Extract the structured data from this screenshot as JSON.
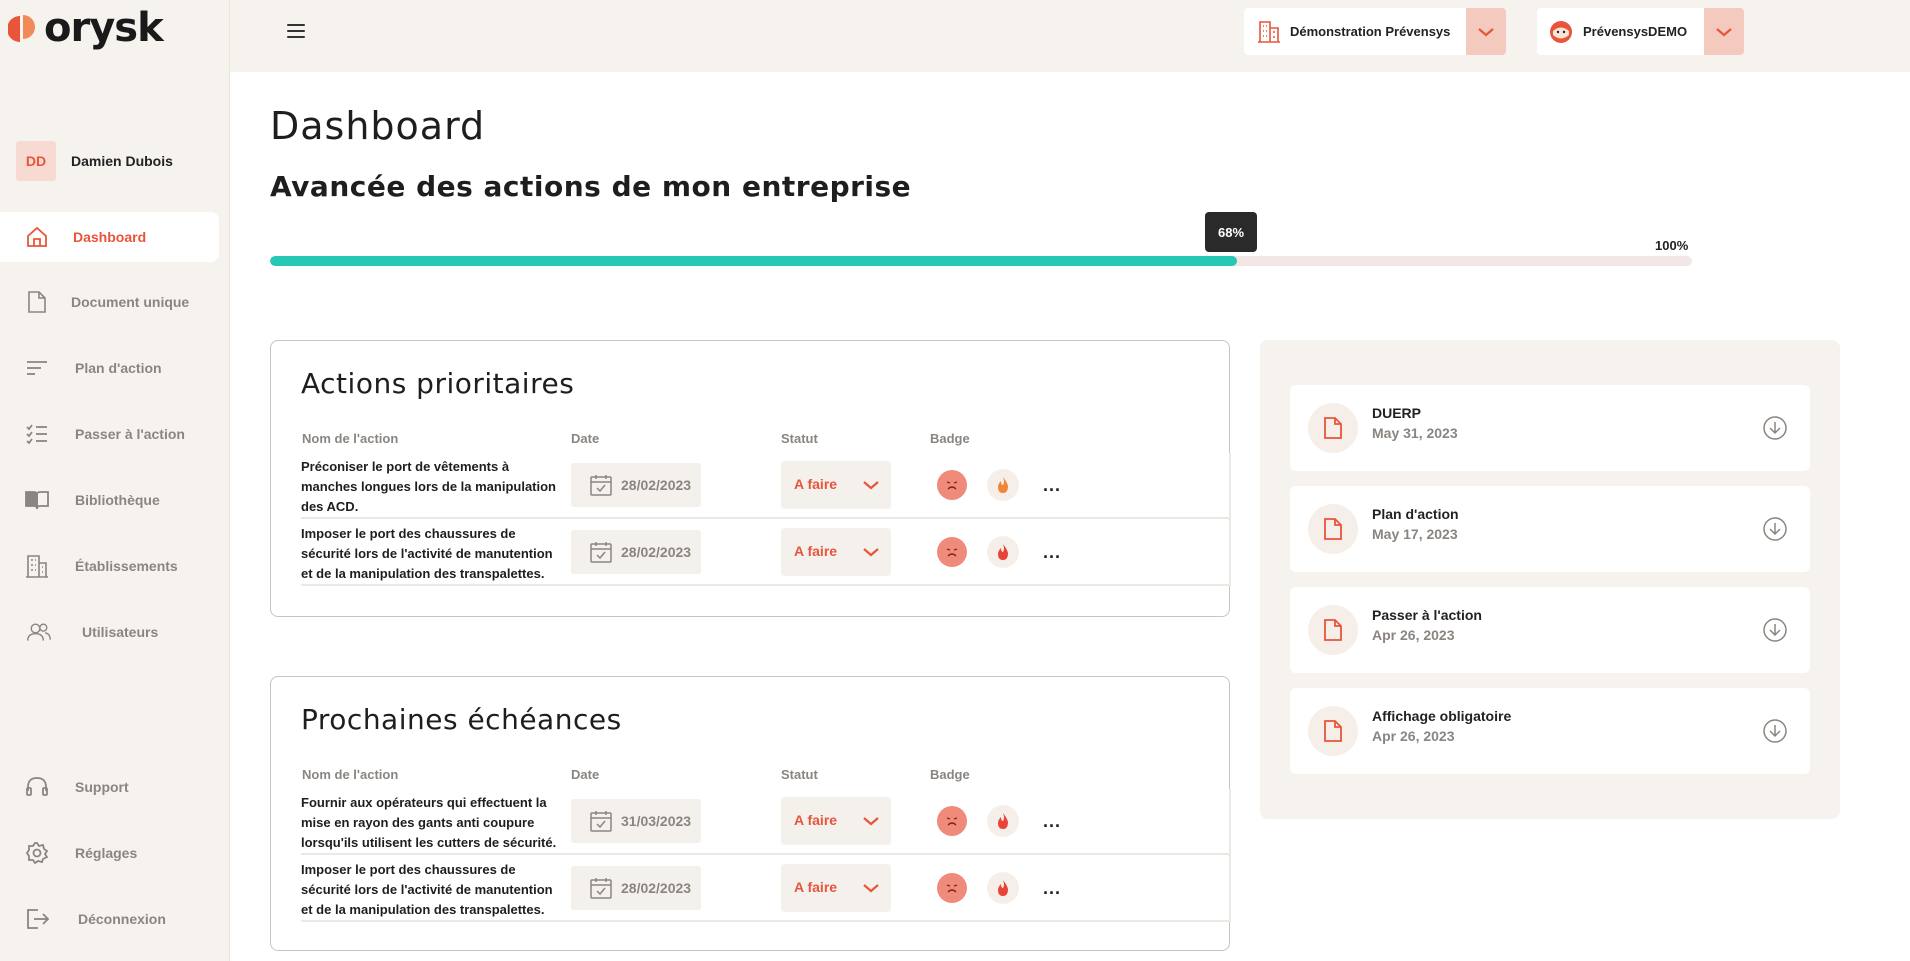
{
  "app": {
    "logo_text": "orysk"
  },
  "user": {
    "initials": "DD",
    "name": "Damien Dubois"
  },
  "sidebar": {
    "items": [
      {
        "label": "Dashboard",
        "icon": "home-icon",
        "active": true
      },
      {
        "label": "Document unique",
        "icon": "document-icon"
      },
      {
        "label": "Plan d'action",
        "icon": "lines-icon"
      },
      {
        "label": "Passer à l'action",
        "icon": "checklist-icon"
      },
      {
        "label": "Bibliothèque",
        "icon": "book-icon"
      },
      {
        "label": "Établissements",
        "icon": "building-icon"
      },
      {
        "label": "Utilisateurs",
        "icon": "users-icon"
      }
    ],
    "bottom_items": [
      {
        "label": "Support",
        "icon": "headset-icon"
      },
      {
        "label": "Réglages",
        "icon": "gear-icon"
      },
      {
        "label": "Déconnexion",
        "icon": "logout-icon"
      }
    ]
  },
  "topbar": {
    "company_selector": {
      "label": "Démonstration Prévensys",
      "icon": "building-icon"
    },
    "account_selector": {
      "label": "PrévensysDEMO",
      "icon": "face-icon"
    }
  },
  "main": {
    "page_title": "Dashboard",
    "progress": {
      "title": "Avancée des actions de mon entreprise",
      "value_label": "68%",
      "value": 68,
      "max_label": "100%"
    }
  },
  "priority_actions": {
    "title": "Actions prioritaires",
    "columns": {
      "name": "Nom de l'action",
      "date": "Date",
      "status": "Statut",
      "badge": "Badge"
    },
    "rows": [
      {
        "name": "Préconiser le port de vêtements à manches longues lors de la manipulation des ACD.",
        "date": "28/02/2023",
        "status": "A faire",
        "fire_color": "#f0863c"
      },
      {
        "name": "Imposer le port des chaussures de sécurité lors de l'activité de manutention et de la manipulation des transpalettes.",
        "date": "28/02/2023",
        "status": "A faire",
        "fire_color": "#e8443a"
      }
    ]
  },
  "upcoming": {
    "title": "Prochaines échéances",
    "columns": {
      "name": "Nom de l'action",
      "date": "Date",
      "status": "Statut",
      "badge": "Badge"
    },
    "rows": [
      {
        "name": "Fournir aux opérateurs qui effectuent la mise en rayon des gants anti coupure lorsqu'ils utilisent les cutters de sécurité.",
        "date": "31/03/2023",
        "status": "A faire",
        "fire_color": "#e8443a"
      },
      {
        "name": "Imposer le port des chaussures de sécurité lors de l'activité de manutention et de la manipulation des transpalettes.",
        "date": "28/02/2023",
        "status": "A faire",
        "fire_color": "#e8443a"
      }
    ]
  },
  "documents": [
    {
      "name": "DUERP",
      "date": "May 31, 2023"
    },
    {
      "name": "Plan d'action",
      "date": "May 17, 2023"
    },
    {
      "name": "Passer à l'action",
      "date": "Apr 26, 2023"
    },
    {
      "name": "Affichage obligatoire",
      "date": "Apr 26, 2023"
    }
  ],
  "more_label": "...",
  "colors": {
    "accent": "#e8553a",
    "progress": "#26c7b5",
    "sidebar_bg": "#f6f3ee"
  }
}
